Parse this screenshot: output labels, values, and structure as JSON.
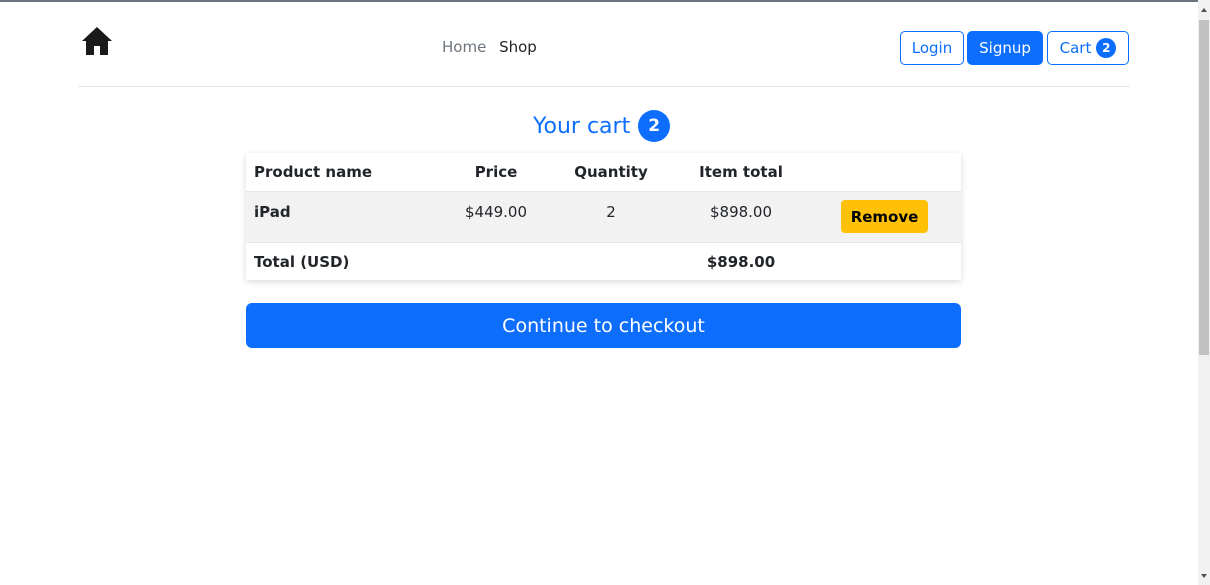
{
  "nav": {
    "home": "Home",
    "shop": "Shop"
  },
  "header_buttons": {
    "login": "Login",
    "signup": "Signup",
    "cart": "Cart",
    "cart_count": "2"
  },
  "cart": {
    "title": "Your cart",
    "count": "2",
    "columns": [
      "Product name",
      "Price",
      "Quantity",
      "Item total"
    ],
    "items": [
      {
        "name": "iPad",
        "price": "$449.00",
        "quantity": "2",
        "item_total": "$898.00",
        "remove_label": "Remove"
      }
    ],
    "total_label": "Total (USD)",
    "total_value": "$898.00",
    "checkout_label": "Continue to checkout"
  },
  "colors": {
    "primary": "#0d6efd",
    "warning": "#ffc107",
    "text": "#212529",
    "muted": "#6c757d"
  },
  "icons": {
    "home": "house-icon"
  }
}
